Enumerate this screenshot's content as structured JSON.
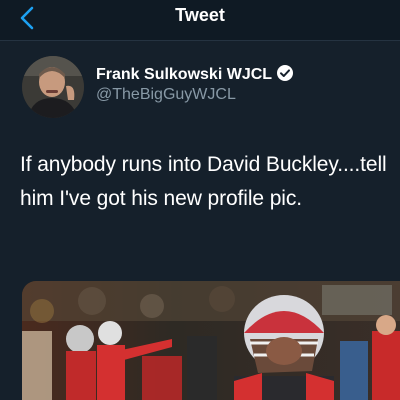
{
  "header": {
    "title": "Tweet",
    "back_icon": "chevron-left-icon",
    "accent_color": "#1da1f2"
  },
  "tweet": {
    "author_name": "Frank Sulkowski WJCL",
    "author_handle": "@TheBigGuyWJCL",
    "verified": true,
    "text": "If anybody runs into David Buckley....tell him I've got his new profile pic.",
    "media_type": "photo",
    "media_subject": "football-player-photo"
  },
  "colors": {
    "background": "#15202b",
    "secondary_text": "#8899a6",
    "verified_badge": "#ffffff"
  }
}
